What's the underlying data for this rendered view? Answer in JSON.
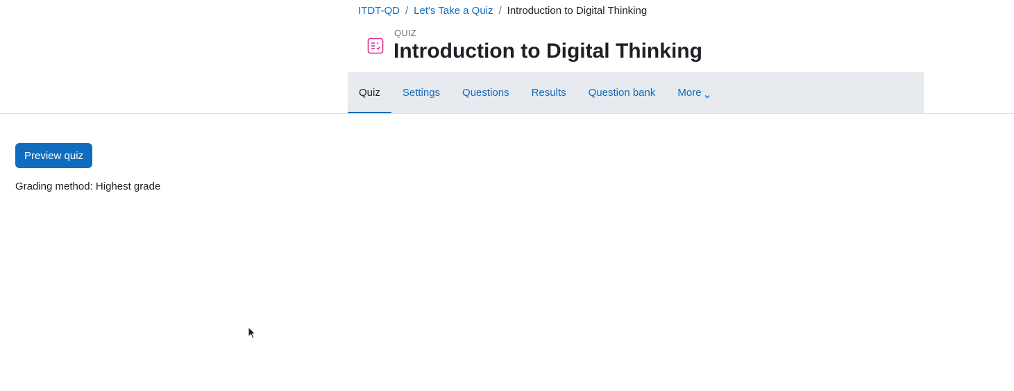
{
  "breadcrumb": {
    "items": [
      "ITDT-QD",
      "Let's Take a Quiz"
    ],
    "current": "Introduction to Digital Thinking",
    "separator": "/"
  },
  "header": {
    "module_label": "QUIZ",
    "title": "Introduction to Digital Thinking",
    "icon": "quiz-icon",
    "icon_color": "#e02d8c"
  },
  "nav": {
    "tabs": [
      {
        "label": "Quiz",
        "active": true
      },
      {
        "label": "Settings",
        "active": false
      },
      {
        "label": "Questions",
        "active": false
      },
      {
        "label": "Results",
        "active": false
      },
      {
        "label": "Question bank",
        "active": false
      },
      {
        "label": "More",
        "active": false
      }
    ]
  },
  "main": {
    "preview_button": "Preview quiz",
    "grading_method": "Grading method: Highest grade"
  },
  "colors": {
    "accent": "#0f6cbf",
    "nav_background": "#e7eaee",
    "text": "#1d2125"
  }
}
